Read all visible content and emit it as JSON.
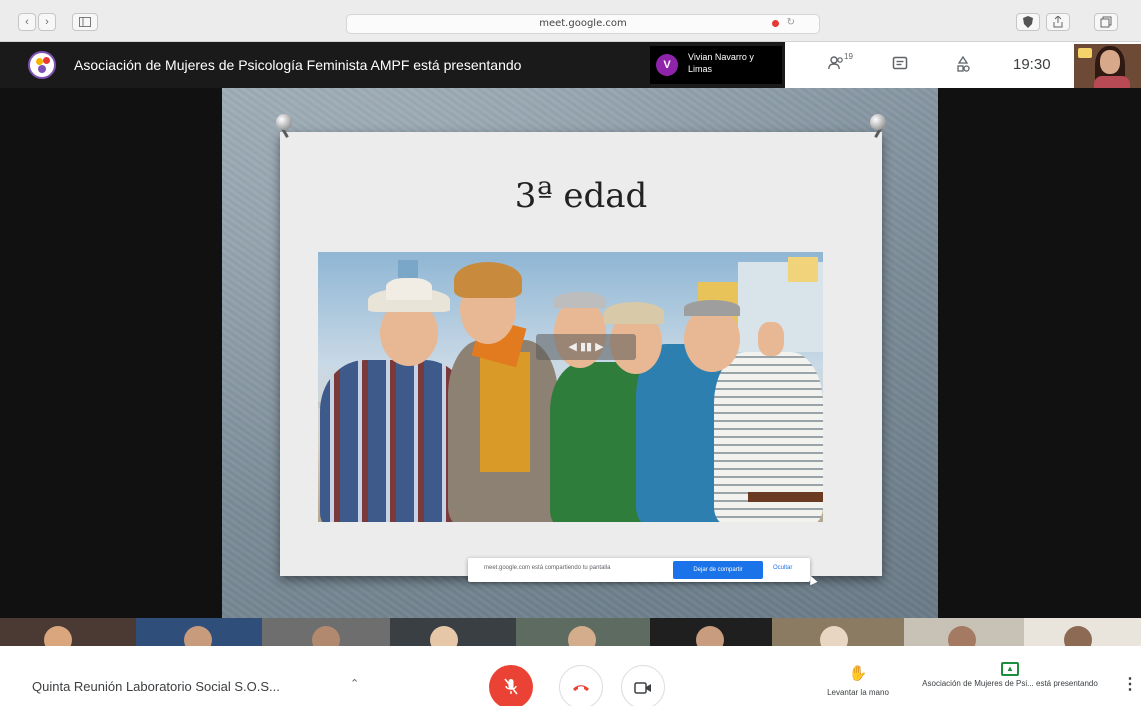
{
  "browser": {
    "url": "meet.google.com",
    "nav_back": "‹",
    "nav_forward": "›",
    "sidebar_icon": "sidebar-icon",
    "actions": [
      "shield-icon",
      "share-icon",
      "tabs-icon"
    ]
  },
  "meet_topbar": {
    "presenting_text": "Asociación de Mujeres de Psicología Feminista AMPF está presentando",
    "presenter_chip": {
      "initial": "V",
      "name": "Vivian Navarro y Limas",
      "color": "#8e24aa"
    },
    "participants_count": "19",
    "time": "19:30"
  },
  "slide": {
    "title": "3ª edad",
    "photo_label": "group-of-elderly-people-photo"
  },
  "share_bar": {
    "message": "meet.google.com está compartiendo tu pantalla",
    "stop_label": "Dejar de compartir",
    "hide_label": "Ocultar"
  },
  "bottombar": {
    "meeting_title": "Quinta Reunión Laboratorio Social S.O.S...",
    "raise_hand_label": "Levantar la mano",
    "presenter_label": "Asociación de Mujeres de Psi... está presentando",
    "colors": {
      "mic_off": "#ea4335",
      "present": "#1e8e3e"
    }
  }
}
